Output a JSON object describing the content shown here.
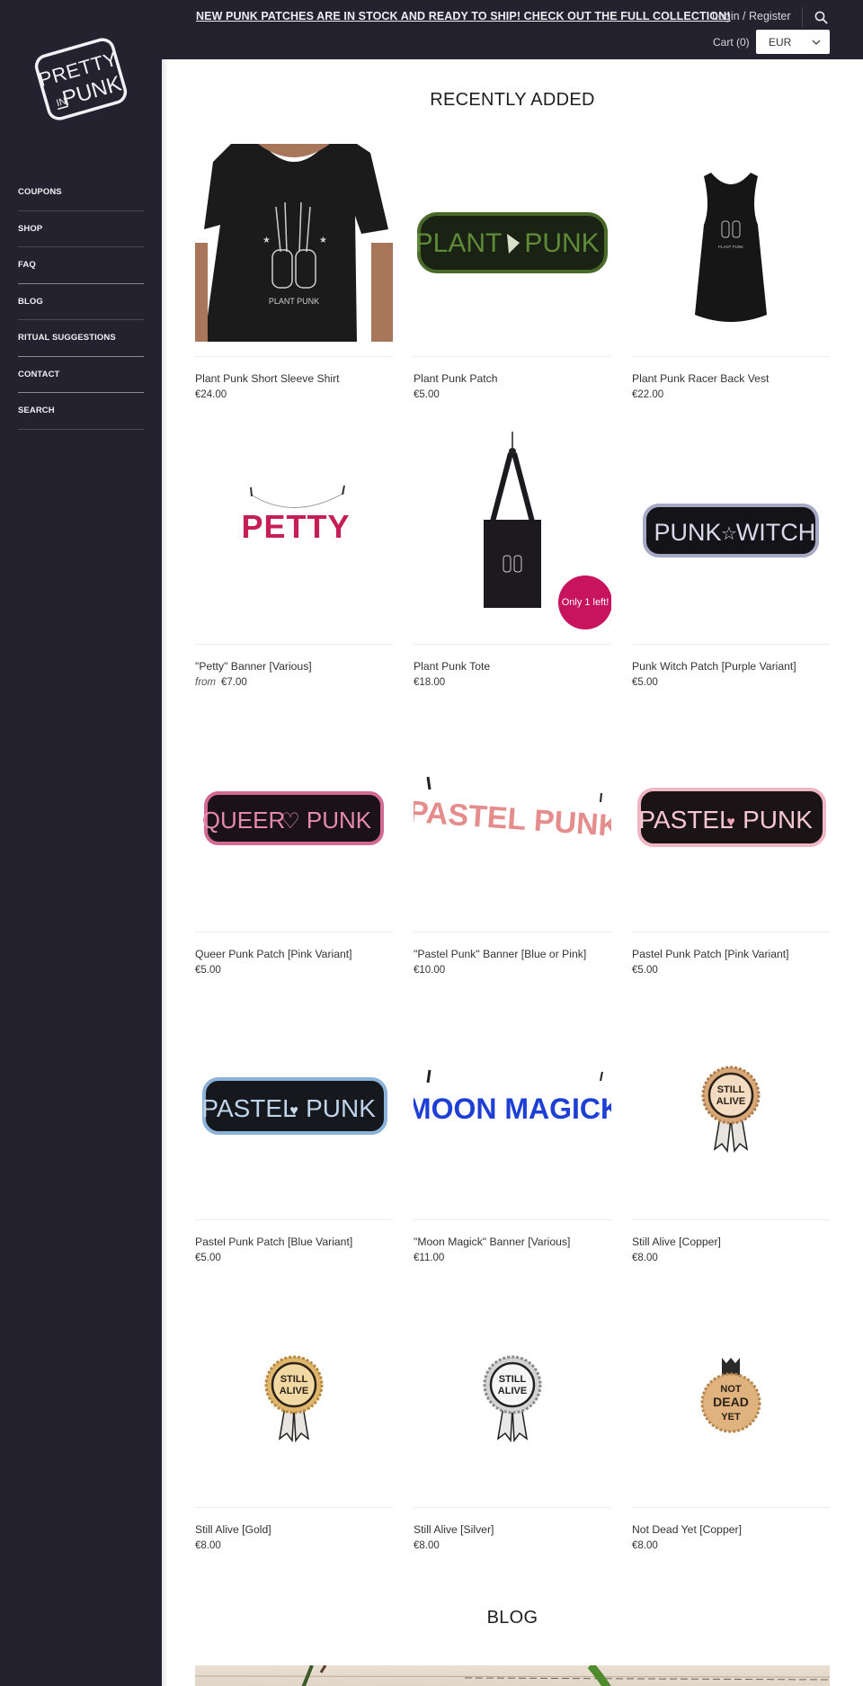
{
  "brand": {
    "logo_line1": "PRETTY",
    "logo_line2_small": "IN",
    "logo_line2": "PUNK"
  },
  "sidebar": {
    "items": [
      {
        "label": "COUPONS"
      },
      {
        "label": "SHOP"
      },
      {
        "label": "FAQ"
      },
      {
        "label": "BLOG"
      },
      {
        "label": "RITUAL SUGGESTIONS"
      },
      {
        "label": "CONTACT"
      },
      {
        "label": "SEARCH"
      }
    ]
  },
  "header": {
    "announcement": "NEW PUNK PATCHES ARE IN STOCK AND READY TO SHIP! CHECK OUT THE FULL COLLECTION!",
    "login_label": "Login / Register",
    "search_icon": "search-icon",
    "cart_label": "Cart (0)",
    "currency": {
      "selected": "EUR"
    }
  },
  "colors": {
    "sidebar_bg": "#24222f",
    "badge": "#c8145e"
  },
  "recently_added": {
    "title": "RECENTLY ADDED",
    "products": [
      {
        "title": "Plant Punk Short Sleeve Shirt",
        "price": "€24.00",
        "from": "",
        "image": "black-tshirt"
      },
      {
        "title": "Plant Punk Patch",
        "price": "€5.00",
        "from": "",
        "image": "green-patch",
        "patch_text": [
          "PLANT",
          "PUNK"
        ]
      },
      {
        "title": "Plant Punk Racer Back Vest",
        "price": "€22.00",
        "from": "",
        "image": "black-vest"
      },
      {
        "title": "\"Petty\" Banner [Various]",
        "price": "€7.00",
        "from": "from",
        "image": "petty-banner",
        "banner_text": "PETTY"
      },
      {
        "title": "Plant Punk Tote",
        "price": "€18.00",
        "from": "",
        "image": "black-tote",
        "badge": "Only 1 left!"
      },
      {
        "title": "Punk Witch Patch [Purple Variant]",
        "price": "€5.00",
        "from": "",
        "image": "purple-patch",
        "patch_text": [
          "PUNK",
          "WITCH"
        ]
      },
      {
        "title": "Queer Punk Patch [Pink Variant]",
        "price": "€5.00",
        "from": "",
        "image": "pink-patch",
        "patch_text": [
          "QUEER",
          "PUNK"
        ]
      },
      {
        "title": "\"Pastel Punk\" Banner [Blue or Pink]",
        "price": "€10.00",
        "from": "",
        "image": "pastel-banner",
        "banner_text": "PASTEL PUNK"
      },
      {
        "title": "Pastel Punk Patch [Pink Variant]",
        "price": "€5.00",
        "from": "",
        "image": "pastel-pink-patch",
        "patch_text": [
          "PASTEL",
          "PUNK"
        ]
      },
      {
        "title": "Pastel Punk Patch [Blue Variant]",
        "price": "€5.00",
        "from": "",
        "image": "pastel-blue-patch",
        "patch_text": [
          "PASTEL",
          "PUNK"
        ]
      },
      {
        "title": "\"Moon Magick\" Banner [Various]",
        "price": "€11.00",
        "from": "",
        "image": "moon-banner",
        "banner_text": "MOON MAGICK"
      },
      {
        "title": "Still Alive [Copper]",
        "price": "€8.00",
        "from": "",
        "image": "copper-pin",
        "pin_text": [
          "STILL",
          "ALIVE"
        ]
      },
      {
        "title": "Still Alive [Gold]",
        "price": "€8.00",
        "from": "",
        "image": "gold-pin",
        "pin_text": [
          "STILL",
          "ALIVE"
        ]
      },
      {
        "title": "Still Alive [Silver]",
        "price": "€8.00",
        "from": "",
        "image": "silver-pin",
        "pin_text": [
          "STILL",
          "ALIVE"
        ]
      },
      {
        "title": "Not Dead Yet [Copper]",
        "price": "€8.00",
        "from": "",
        "image": "notdead-pin",
        "pin_text": [
          "NOT",
          "DEAD",
          "YET"
        ]
      }
    ]
  },
  "blog": {
    "title": "BLOG"
  }
}
